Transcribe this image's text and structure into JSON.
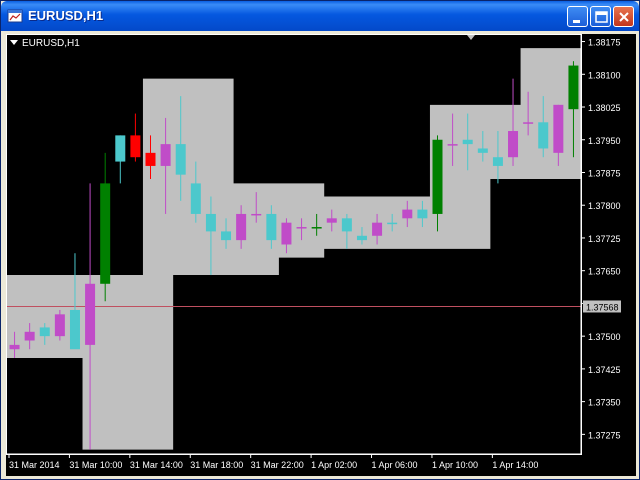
{
  "window": {
    "title": "EURUSD,H1",
    "icon": "chart-window-icon"
  },
  "chart": {
    "symbol_label": "EURUSD,H1"
  },
  "colors": {
    "background": "#000000",
    "band": "#c0c0c0",
    "bull": "#4cc8cc",
    "bear": "#c04cc8",
    "trend_up": "#008000",
    "trend_down": "#ff0000",
    "bid_line": "#c05060",
    "axis": "#ffffff"
  },
  "chart_data": {
    "type": "candlestick",
    "y_ticks": [
      "1.38175",
      "1.38100",
      "1.38025",
      "1.37950",
      "1.37875",
      "1.37800",
      "1.37725",
      "1.37650",
      "1.37575",
      "1.37500",
      "1.37425",
      "1.37350",
      "1.37275"
    ],
    "x_labels": [
      "31 Mar 2014",
      "31 Mar 10:00",
      "31 Mar 14:00",
      "31 Mar 18:00",
      "31 Mar 22:00",
      "1 Apr 02:00",
      "1 Apr 06:00",
      "1 Apr 10:00",
      "1 Apr 14:00"
    ],
    "current_price": "1.37568",
    "ylim": [
      1.3723,
      1.3819
    ],
    "candles": [
      {
        "o": 1.3747,
        "h": 1.3751,
        "l": 1.3745,
        "c": 1.3748,
        "k": "bear"
      },
      {
        "o": 1.3749,
        "h": 1.3753,
        "l": 1.3747,
        "c": 1.3751,
        "k": "bear"
      },
      {
        "o": 1.375,
        "h": 1.3753,
        "l": 1.3748,
        "c": 1.3752,
        "k": "bull"
      },
      {
        "o": 1.375,
        "h": 1.3756,
        "l": 1.3749,
        "c": 1.3755,
        "k": "bear"
      },
      {
        "o": 1.3756,
        "h": 1.3769,
        "l": 1.3748,
        "c": 1.3747,
        "k": "bull"
      },
      {
        "o": 1.3748,
        "h": 1.3785,
        "l": 1.3724,
        "c": 1.3762,
        "k": "bear"
      },
      {
        "o": 1.3762,
        "h": 1.3792,
        "l": 1.3758,
        "c": 1.3785,
        "k": "up"
      },
      {
        "o": 1.379,
        "h": 1.3796,
        "l": 1.3785,
        "c": 1.3796,
        "k": "bull"
      },
      {
        "o": 1.3796,
        "h": 1.3801,
        "l": 1.379,
        "c": 1.3791,
        "k": "down"
      },
      {
        "o": 1.3792,
        "h": 1.3796,
        "l": 1.3786,
        "c": 1.3789,
        "k": "down"
      },
      {
        "o": 1.3789,
        "h": 1.38,
        "l": 1.3778,
        "c": 1.3794,
        "k": "bear"
      },
      {
        "o": 1.3794,
        "h": 1.3805,
        "l": 1.3781,
        "c": 1.3787,
        "k": "bull"
      },
      {
        "o": 1.3785,
        "h": 1.379,
        "l": 1.3776,
        "c": 1.3778,
        "k": "bull"
      },
      {
        "o": 1.3778,
        "h": 1.3782,
        "l": 1.3764,
        "c": 1.3774,
        "k": "bull"
      },
      {
        "o": 1.3774,
        "h": 1.3777,
        "l": 1.377,
        "c": 1.3772,
        "k": "bull"
      },
      {
        "o": 1.3772,
        "h": 1.378,
        "l": 1.377,
        "c": 1.3778,
        "k": "bear"
      },
      {
        "o": 1.3778,
        "h": 1.3783,
        "l": 1.3776,
        "c": 1.3778,
        "k": "bear"
      },
      {
        "o": 1.3778,
        "h": 1.378,
        "l": 1.377,
        "c": 1.3772,
        "k": "bull"
      },
      {
        "o": 1.3771,
        "h": 1.3777,
        "l": 1.3769,
        "c": 1.3776,
        "k": "bear"
      },
      {
        "o": 1.3775,
        "h": 1.3777,
        "l": 1.3772,
        "c": 1.3775,
        "k": "bear"
      },
      {
        "o": 1.3775,
        "h": 1.3778,
        "l": 1.3773,
        "c": 1.3775,
        "k": "up"
      },
      {
        "o": 1.3776,
        "h": 1.3779,
        "l": 1.3774,
        "c": 1.3777,
        "k": "bear"
      },
      {
        "o": 1.3777,
        "h": 1.3778,
        "l": 1.377,
        "c": 1.3774,
        "k": "bull"
      },
      {
        "o": 1.3773,
        "h": 1.3775,
        "l": 1.3771,
        "c": 1.3772,
        "k": "bull"
      },
      {
        "o": 1.3773,
        "h": 1.3778,
        "l": 1.3771,
        "c": 1.3776,
        "k": "bear"
      },
      {
        "o": 1.3776,
        "h": 1.3778,
        "l": 1.3774,
        "c": 1.3776,
        "k": "bull"
      },
      {
        "o": 1.3777,
        "h": 1.3781,
        "l": 1.3775,
        "c": 1.3779,
        "k": "bear"
      },
      {
        "o": 1.3779,
        "h": 1.3781,
        "l": 1.3775,
        "c": 1.3777,
        "k": "bull"
      },
      {
        "o": 1.3778,
        "h": 1.3796,
        "l": 1.3774,
        "c": 1.3795,
        "k": "up"
      },
      {
        "o": 1.3794,
        "h": 1.3801,
        "l": 1.3789,
        "c": 1.3794,
        "k": "bear"
      },
      {
        "o": 1.3795,
        "h": 1.3801,
        "l": 1.3788,
        "c": 1.3794,
        "k": "bull"
      },
      {
        "o": 1.3793,
        "h": 1.3797,
        "l": 1.379,
        "c": 1.3792,
        "k": "bull"
      },
      {
        "o": 1.3791,
        "h": 1.3797,
        "l": 1.3785,
        "c": 1.3789,
        "k": "bull"
      },
      {
        "o": 1.3791,
        "h": 1.3809,
        "l": 1.3789,
        "c": 1.3797,
        "k": "bear"
      },
      {
        "o": 1.3799,
        "h": 1.3806,
        "l": 1.3796,
        "c": 1.3799,
        "k": "bear"
      },
      {
        "o": 1.3799,
        "h": 1.3805,
        "l": 1.3791,
        "c": 1.3793,
        "k": "bull"
      },
      {
        "o": 1.3792,
        "h": 1.3803,
        "l": 1.3789,
        "c": 1.3803,
        "k": "bear"
      },
      {
        "o": 1.3802,
        "h": 1.3813,
        "l": 1.3791,
        "c": 1.3812,
        "k": "up"
      }
    ],
    "band_upper": [
      1.3764,
      1.3764,
      1.3764,
      1.3764,
      1.3764,
      1.3764,
      1.3764,
      1.3764,
      1.3764,
      1.3809,
      1.3809,
      1.3809,
      1.3809,
      1.3809,
      1.3809,
      1.3785,
      1.3785,
      1.3785,
      1.3785,
      1.3785,
      1.3785,
      1.3782,
      1.3782,
      1.3782,
      1.3782,
      1.3782,
      1.3782,
      1.3782,
      1.3803,
      1.3803,
      1.3803,
      1.3803,
      1.3803,
      1.3803,
      1.3816,
      1.3816,
      1.3816,
      1.3816
    ],
    "band_lower": [
      1.3745,
      1.3745,
      1.3745,
      1.3745,
      1.3745,
      1.3724,
      1.3724,
      1.3724,
      1.3724,
      1.3724,
      1.3724,
      1.3764,
      1.3764,
      1.3764,
      1.3764,
      1.3764,
      1.3764,
      1.3764,
      1.3768,
      1.3768,
      1.3768,
      1.377,
      1.377,
      1.377,
      1.377,
      1.377,
      1.377,
      1.377,
      1.377,
      1.377,
      1.377,
      1.377,
      1.3786,
      1.3786,
      1.3786,
      1.3786,
      1.3786,
      1.3786
    ]
  }
}
